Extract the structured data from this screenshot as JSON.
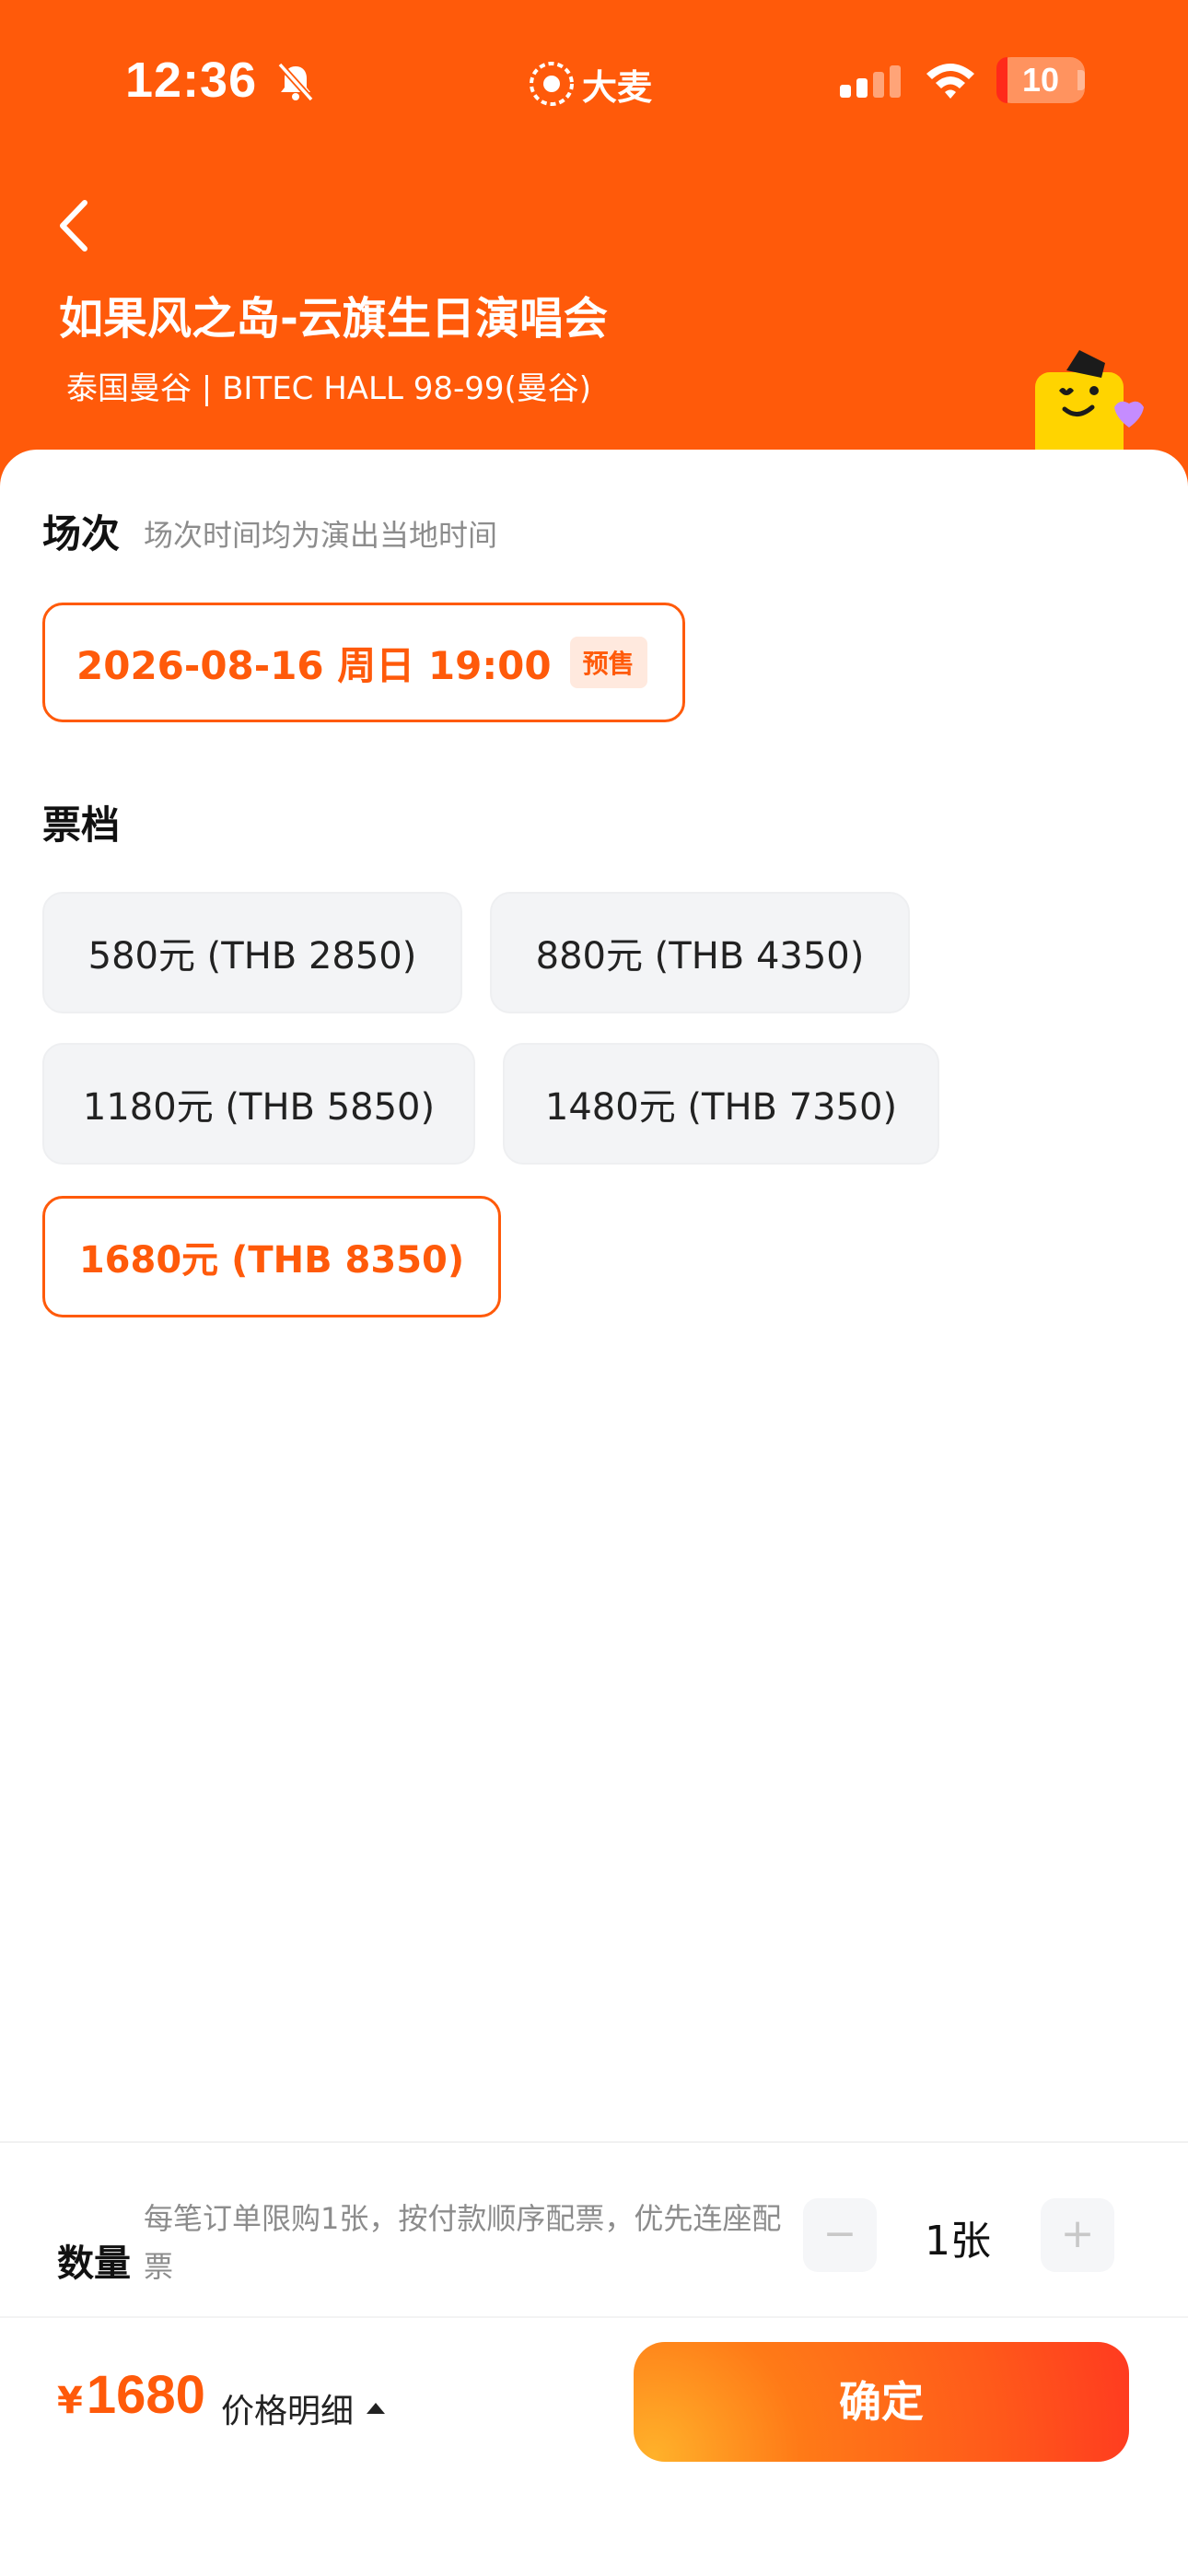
{
  "status_bar": {
    "time": "12:36",
    "brand_name": "大麦",
    "battery_level": "10"
  },
  "header": {
    "title": "如果风之岛-云旗生日演唱会",
    "venue": "泰国曼谷 | BITEC HALL 98-99(曼谷)"
  },
  "session": {
    "title": "场次",
    "hint": "场次时间均为演出当地时间",
    "selected_date": "2026-08-16  周日 19:00",
    "badge": "预售"
  },
  "tiers": {
    "title": "票档",
    "options": [
      {
        "label": "580元 (THB 2850)",
        "selected": false
      },
      {
        "label": "880元 (THB 4350)",
        "selected": false
      },
      {
        "label": "1180元 (THB 5850)",
        "selected": false
      },
      {
        "label": "1480元 (THB 7350)",
        "selected": false
      },
      {
        "label": "1680元 (THB 8350)",
        "selected": true
      }
    ]
  },
  "quantity": {
    "label": "数量",
    "note": "每笔订单限购1张，按付款顺序配票，优先连座配票",
    "minus": "−",
    "plus": "+",
    "value": "1张"
  },
  "footer": {
    "currency": "¥",
    "price": "1680",
    "price_detail": "价格明细",
    "confirm": "确定"
  },
  "colors": {
    "accent": "#ff5a0a",
    "selected_border": "#ff5a0a",
    "hint": "#8c8c8c"
  }
}
